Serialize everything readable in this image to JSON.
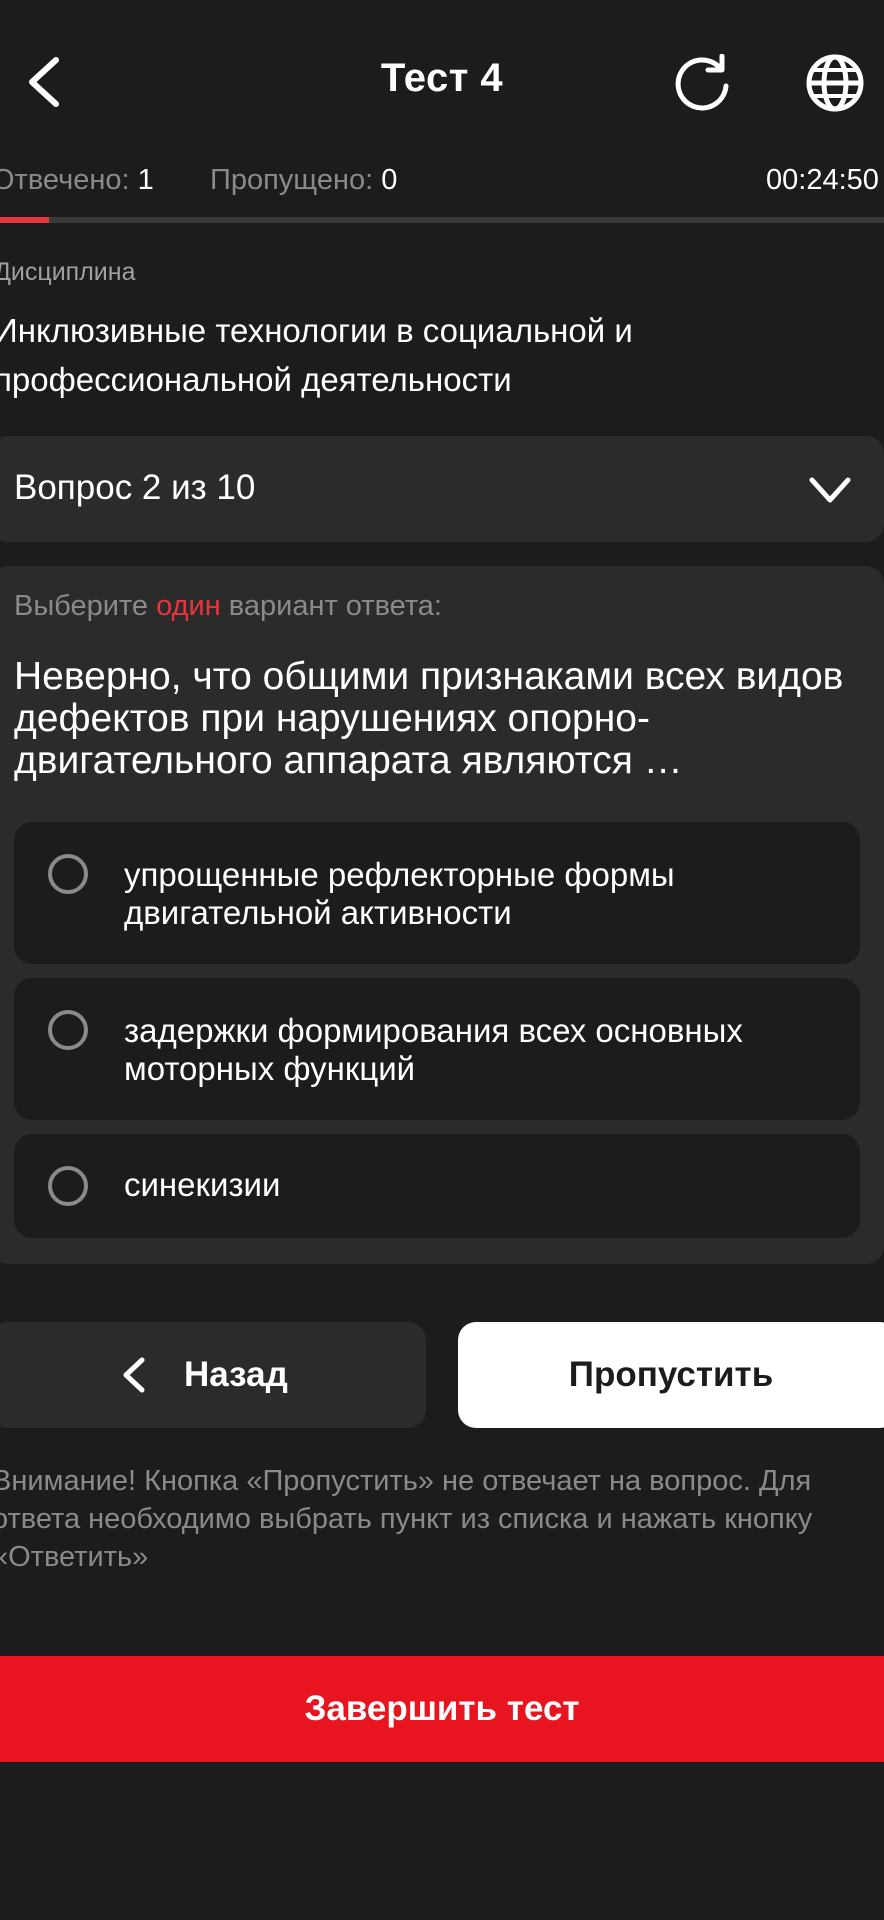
{
  "header": {
    "title": "Тест 4"
  },
  "stats": {
    "answered_label": "Отвечено:",
    "answered_value": "1",
    "skipped_label": "Пропущено:",
    "skipped_value": "0",
    "timer": "00:24:50",
    "progress": 0.055
  },
  "discipline": {
    "label": "Дисциплина",
    "name": "Инклюзивные технологии в социальной и профессиональной деятельности"
  },
  "question_selector": {
    "label": "Вопрос 2 из 10"
  },
  "question": {
    "instruction_prefix": "Выберите",
    "instruction_accent": "один",
    "instruction_suffix": "вариант ответа:",
    "text": "Неверно, что общими признаками всех видов дефектов при нарушениях опорно-двигательного аппарата являются …",
    "options": [
      {
        "text": "упрощенные рефлекторные формы двигательной активности"
      },
      {
        "text": "задержки формирования всех основных моторных функций"
      },
      {
        "text": "синекизии"
      }
    ]
  },
  "buttons": {
    "back": "Назад",
    "skip": "Пропустить",
    "finish": "Завершить тест"
  },
  "warning": "Внимание! Кнопка «Пропустить» не отвечает на вопрос. Для ответа необходимо выбрать пункт из списка и нажать кнопку «Ответить»",
  "colors": {
    "background": "#1c1c1c",
    "card": "#2b2b2b",
    "accent_red": "#e8353c",
    "finish_red": "#e8141f",
    "muted_text": "#8a8a8a"
  },
  "icons": {
    "back": "chevron-left-icon",
    "refresh": "refresh-icon",
    "language": "globe-icon",
    "expand": "chevron-down-icon",
    "radio": "radio-unchecked-icon"
  }
}
